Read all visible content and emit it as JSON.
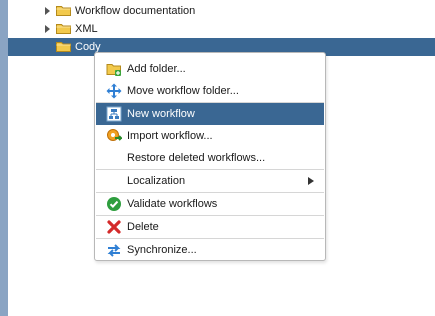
{
  "tree": {
    "items": [
      {
        "label": "Workflow documentation"
      },
      {
        "label": "XML"
      },
      {
        "label": "Cody"
      }
    ]
  },
  "context_menu": {
    "items": [
      {
        "label": "Add folder...",
        "icon": "add-folder-icon"
      },
      {
        "label": "Move workflow folder...",
        "icon": "move-icon"
      },
      {
        "label": "New workflow",
        "icon": "new-workflow-icon"
      },
      {
        "label": "Import workflow...",
        "icon": "import-workflow-icon"
      },
      {
        "label": "Restore deleted workflows...",
        "icon": ""
      },
      {
        "label": "Localization",
        "icon": "",
        "has_submenu": true
      },
      {
        "label": "Validate workflows",
        "icon": "check-circle-icon"
      },
      {
        "label": "Delete",
        "icon": "delete-x-icon"
      },
      {
        "label": "Synchronize...",
        "icon": "sync-icon"
      }
    ]
  },
  "colors": {
    "selection": "#3a6793",
    "left_strip": "#8aa4c3",
    "folder": "#f2c94c"
  }
}
